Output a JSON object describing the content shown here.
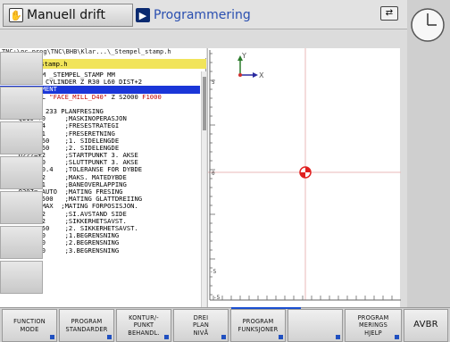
{
  "header": {
    "mode_left": "Manuell drift",
    "mode_right": "Programmering",
    "mode_left_icon": "hand-icon",
    "mode_right_icon": "program-icon",
    "toggle_icon": "swap-arrows-icon"
  },
  "program": {
    "path": "TNC:\\nc_prog\\TNC\\BHB\\Klar...\\_Stempel_stamp.h",
    "file": "→ Stempel_stamp.h",
    "lines": [
      {
        "no": "0",
        "text": "BEGIN PGM _STEMPEL_STAMP MM"
      },
      {
        "no": "1",
        "text": "BLK FORM CYLINDER Z R30 L60 DIST+2"
      },
      {
        "no": "2",
        "text": ";ANY COMMENT",
        "selected": true
      },
      {
        "no": "3",
        "text": "TOOL CALL ",
        "tool": "\"FACE_MILL_D40\"",
        "rest": " Z S2000 ",
        "tail": "F1000"
      },
      {
        "no": "4",
        "text": "M3"
      },
      {
        "no": "5",
        "text": "CYCL DEF 233 PLANFRESING"
      },
      {
        "no": "",
        "text": "  Q215=+0     ;MASKINOPERASJON"
      },
      {
        "no": "",
        "text": "  Q389=+4     ;FRESESTRATEGI"
      },
      {
        "no": "",
        "text": "  Q350=+1     ;FRESERETNING"
      },
      {
        "no": "",
        "text": "  Q218=-60    ;1. SIDELENGDE"
      },
      {
        "no": "",
        "text": "  Q219=+60    ;2. SIDELENGDE"
      },
      {
        "no": "",
        "text": "  Q227=+2     ;STARTPUNKT 3. AKSE"
      },
      {
        "no": "",
        "text": "  Q386=+0     ;SLUTTPUNKT 3. AKSE"
      },
      {
        "no": "",
        "text": "  Q369=+0.4   ;TOLERANSE FOR DYBDE"
      },
      {
        "no": "",
        "text": "  Q202=+2     ;MAKS. MATEDYBDE"
      },
      {
        "no": "",
        "text": "  Q370=+1     ;BANEOVERLAPPING"
      },
      {
        "no": "",
        "text": "  Q207= AUTO  ;MATING FRESING"
      },
      {
        "no": "",
        "text": "  Q385=+500   ;MATING GLATTDREIING"
      },
      {
        "no": "",
        "text": "  Q253= MAX  ;MATING FORPOSISJON."
      },
      {
        "no": "",
        "text": "  Q357=+2     ;SI.AVSTAND SIDE"
      },
      {
        "no": "",
        "text": "  Q200=+2     ;SIKKERHETSAVST."
      },
      {
        "no": "",
        "text": "  Q204=+50    ;2. SIKKERHETSAVST."
      },
      {
        "no": "",
        "text": "  Q347=+0     ;1.BEGRENSNING"
      },
      {
        "no": "",
        "text": "  Q348=+0     ;2.BEGRENSNING"
      },
      {
        "no": "",
        "text": "  Q349=+0     ;3.BEGRENSNING"
      }
    ]
  },
  "graphics": {
    "axis_y": "Y",
    "axis_x": "X",
    "ruler_left_labels": [
      "5",
      "0",
      "-5"
    ],
    "ruler_bottom_labels": [
      "-5",
      "0",
      "5"
    ]
  },
  "softkeys": [
    {
      "lines": [
        "FUNCTION",
        "MODE"
      ]
    },
    {
      "lines": [
        "PROGRAM",
        "STANDARDER"
      ]
    },
    {
      "lines": [
        "KONTUR/-",
        "PUNKT",
        "BEHANDL."
      ]
    },
    {
      "lines": [
        "DREI",
        "PLAN",
        "NIVÅ"
      ]
    },
    {
      "lines": [
        "PROGRAM",
        "FUNKSJONER"
      ]
    },
    {
      "lines": [
        ""
      ]
    },
    {
      "lines": [
        "PROGRAM",
        "MERINGS",
        "HJELP"
      ]
    },
    {
      "lines": [
        "AVBR"
      ]
    }
  ],
  "colors": {
    "selection": "#1a36d8",
    "file_bar": "#f1e45a",
    "line_numbers": "#c00000",
    "tool_name": "#c00000",
    "datum": "#e02020"
  }
}
